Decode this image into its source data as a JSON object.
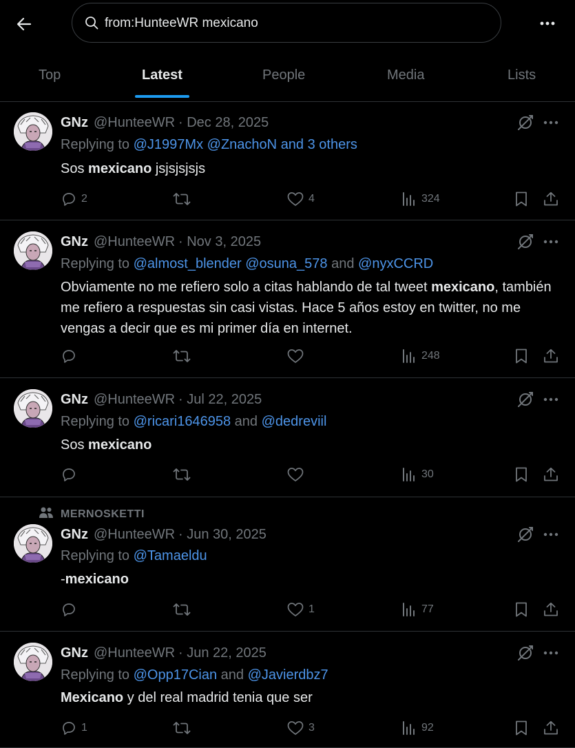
{
  "header": {
    "search_query": "from:HunteeWR mexicano",
    "tabs": [
      {
        "label": "Top",
        "active": false
      },
      {
        "label": "Latest",
        "active": true
      },
      {
        "label": "People",
        "active": false
      },
      {
        "label": "Media",
        "active": false
      },
      {
        "label": "Lists",
        "active": false
      }
    ]
  },
  "icons": {
    "back": "arrow-left-icon",
    "search": "search-icon",
    "more": "more-icon",
    "reply": "reply-icon",
    "retweet": "retweet-icon",
    "like": "heart-icon",
    "views": "views-icon",
    "bookmark": "bookmark-icon",
    "share": "share-icon",
    "grok": "grok-icon"
  },
  "colors": {
    "background": "#000000",
    "text": "#e7e9ea",
    "muted": "#71767b",
    "link": "#4d94e8",
    "accent": "#1d9bf0",
    "border": "#2f3336"
  },
  "tweets": [
    {
      "name": "GNz",
      "handle": "@HunteeWR",
      "date": "· Dec 28, 2025",
      "replying_prefix": "Replying to",
      "replying_segments": [
        {
          "text": "@J1997Mx",
          "link": true
        },
        {
          "text": " ",
          "link": false
        },
        {
          "text": "@ZnachoN",
          "link": true
        },
        {
          "text": " ",
          "link": false
        },
        {
          "text": "and 3 others",
          "link": true
        }
      ],
      "text_segments": [
        {
          "text": "Sos ",
          "bold": false
        },
        {
          "text": "mexicano",
          "bold": true
        },
        {
          "text": " jsjsjsjsjs",
          "bold": false
        }
      ],
      "replies": "2",
      "retweets": "",
      "likes": "4",
      "views": "324"
    },
    {
      "name": "GNz",
      "handle": "@HunteeWR",
      "date": "· Nov 3, 2025",
      "replying_prefix": "Replying to",
      "replying_segments": [
        {
          "text": "@almost_blender",
          "link": true
        },
        {
          "text": " ",
          "link": false
        },
        {
          "text": "@osuna_578",
          "link": true
        },
        {
          "text": " and ",
          "link": false
        },
        {
          "text": "@nyxCCRD",
          "link": true
        }
      ],
      "text_segments": [
        {
          "text": "Obviamente no me refiero solo a citas hablando de tal tweet ",
          "bold": false
        },
        {
          "text": "mexicano",
          "bold": true
        },
        {
          "text": ", también me refiero a respuestas sin casi vistas. Hace 5 años estoy en twitter, no me vengas a decir que es mi primer día en internet.",
          "bold": false
        }
      ],
      "replies": "",
      "retweets": "",
      "likes": "",
      "views": "248"
    },
    {
      "name": "GNz",
      "handle": "@HunteeWR",
      "date": "· Jul 22, 2025",
      "replying_prefix": "Replying to",
      "replying_segments": [
        {
          "text": "@ricari1646958",
          "link": true
        },
        {
          "text": " and ",
          "link": false
        },
        {
          "text": "@dedreviil",
          "link": true
        }
      ],
      "text_segments": [
        {
          "text": "Sos ",
          "bold": false
        },
        {
          "text": "mexicano",
          "bold": true
        }
      ],
      "replies": "",
      "retweets": "",
      "likes": "",
      "views": "30"
    },
    {
      "social_context": "MERNOSKETTI",
      "name": "GNz",
      "handle": "@HunteeWR",
      "date": "· Jun 30, 2025",
      "replying_prefix": "Replying to",
      "replying_segments": [
        {
          "text": "@Tamaeldu",
          "link": true
        }
      ],
      "text_segments": [
        {
          "text": "-",
          "bold": false
        },
        {
          "text": "mexicano",
          "bold": true
        }
      ],
      "replies": "",
      "retweets": "",
      "likes": "1",
      "views": "77"
    },
    {
      "name": "GNz",
      "handle": "@HunteeWR",
      "date": "· Jun 22, 2025",
      "replying_prefix": "Replying to",
      "replying_segments": [
        {
          "text": "@Opp17Cian",
          "link": true
        },
        {
          "text": " and ",
          "link": false
        },
        {
          "text": "@Javierdbz7",
          "link": true
        }
      ],
      "text_segments": [
        {
          "text": "Mexicano",
          "bold": true
        },
        {
          "text": " y del real madrid tenia que ser",
          "bold": false
        }
      ],
      "replies": "1",
      "retweets": "",
      "likes": "3",
      "views": "92"
    }
  ]
}
